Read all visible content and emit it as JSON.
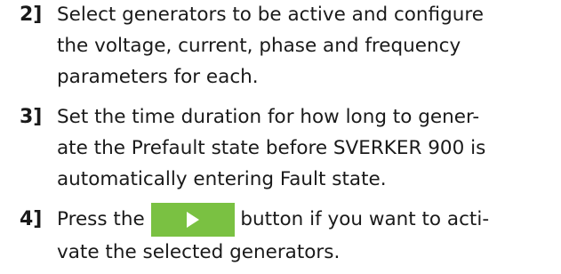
{
  "steps": [
    {
      "number": "2]",
      "lines": [
        "Select generators to be active and configure",
        "the voltage, current, phase and frequency",
        "parameters for each."
      ]
    },
    {
      "number": "3]",
      "lines": [
        "Set the time duration for how long to gener-",
        "ate the Prefault state before SVERKER 900 is",
        "automatically entering Fault state."
      ]
    },
    {
      "number": "4]",
      "line1_before": "Press the",
      "line1_after": "button if you want to acti-",
      "line2": "vate the selected generators.",
      "button_icon": "play-icon",
      "button_color": "#7ac142"
    }
  ]
}
